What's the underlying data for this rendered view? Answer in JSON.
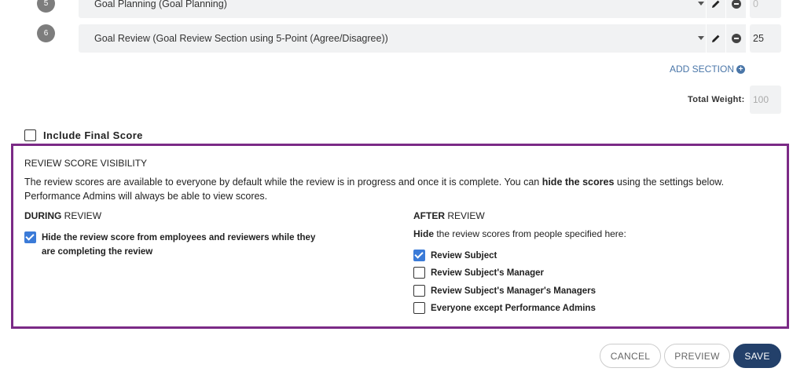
{
  "sections": [
    {
      "number": "5",
      "name": "Goal Planning (Goal Planning)",
      "weight": "0",
      "weight_dim": true
    },
    {
      "number": "6",
      "name": "Goal Review (Goal Review Section using 5-Point (Agree/Disagree))",
      "weight": "25",
      "weight_dim": false
    }
  ],
  "add_section": {
    "label": "ADD SECTION",
    "icon": "plus-circle-icon"
  },
  "total_weight": {
    "label": "Total Weight:",
    "value": "100"
  },
  "final_score": {
    "label": "Include Final Score",
    "checked": false
  },
  "visibility": {
    "title": "REVIEW SCORE VISIBILITY",
    "desc_before": "The review scores are available to everyone by default while the review is in progress and once it is complete. You can ",
    "desc_bold": "hide the scores",
    "desc_after": " using the settings below. Performance Admins will always be able to view scores.",
    "during": {
      "heading_bold": "DURING",
      "heading_rest": " REVIEW",
      "option_line1": "Hide the review score from employees and reviewers while they",
      "option_line2": "are completing the review",
      "option_checked": true
    },
    "after": {
      "heading_bold": "AFTER",
      "heading_rest": " REVIEW",
      "hide_bold": "Hide",
      "hide_rest": " the review scores from people specified here:",
      "options": [
        {
          "label": "Review Subject",
          "checked": true
        },
        {
          "label": "Review Subject's Manager",
          "checked": false
        },
        {
          "label": "Review Subject's Manager's Managers",
          "checked": false
        },
        {
          "label": "Everyone except Performance Admins",
          "checked": false
        }
      ]
    }
  },
  "buttons": {
    "cancel": "CANCEL",
    "preview": "PREVIEW",
    "save": "SAVE"
  },
  "colors": {
    "accent": "#7b2a86",
    "primary": "#23406a",
    "check": "#3b7bd8",
    "link": "#4a76a8"
  }
}
